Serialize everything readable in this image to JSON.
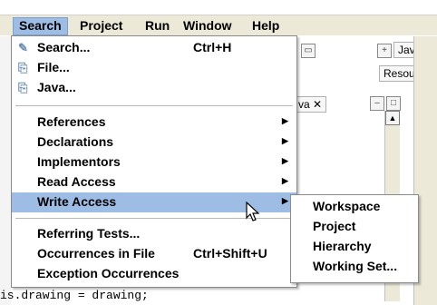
{
  "menubar": [
    {
      "label": "Search",
      "active": true
    },
    {
      "label": "Project"
    },
    {
      "label": "Run"
    },
    {
      "label": "Window"
    },
    {
      "label": "Help"
    }
  ],
  "search_menu": {
    "items": [
      {
        "label": "Search...",
        "shortcut": "Ctrl+H",
        "icon": "search-flashlight-icon"
      },
      {
        "label": "File...",
        "shortcut": "",
        "icon": "file-search-icon"
      },
      {
        "label": "Java...",
        "shortcut": "",
        "icon": "java-search-icon"
      },
      {
        "label": "References",
        "submenu": true
      },
      {
        "label": "Declarations",
        "submenu": true
      },
      {
        "label": "Implementors",
        "submenu": true
      },
      {
        "label": "Read Access",
        "submenu": true
      },
      {
        "label": "Write Access",
        "submenu": true,
        "highlighted": true
      },
      {
        "label": "Referring Tests..."
      },
      {
        "label": "Occurrences in File",
        "shortcut": "Ctrl+Shift+U"
      },
      {
        "label": "Exception Occurrences"
      }
    ]
  },
  "write_access_submenu": {
    "items": [
      "Workspace",
      "Project",
      "Hierarchy",
      "Working Set..."
    ]
  },
  "background": {
    "tab_label": "va",
    "code_line": "is.drawing = drawing;",
    "perspective_java": "Java",
    "perspective_resource": "Resourc"
  },
  "colors": {
    "highlight": "#9ebde5",
    "menubar": "#ece9d8"
  }
}
